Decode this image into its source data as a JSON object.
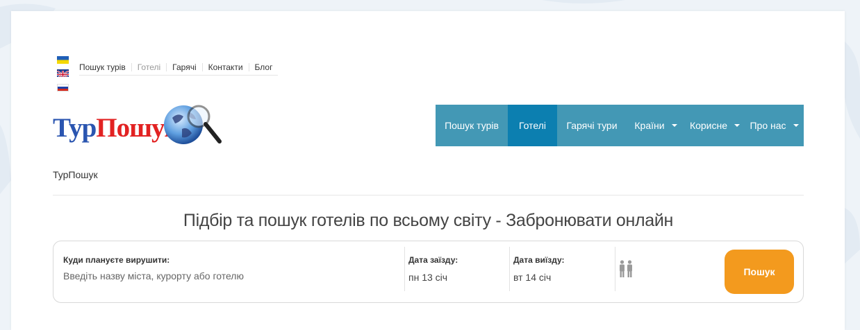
{
  "languages": [
    {
      "name": "uk",
      "icon": "flag-ukraine-icon"
    },
    {
      "name": "en",
      "icon": "flag-uk-icon"
    },
    {
      "name": "ru",
      "icon": "flag-russia-icon"
    }
  ],
  "top_links": [
    {
      "label": "Пошук турів",
      "active": false
    },
    {
      "label": "Готелі",
      "active": true
    },
    {
      "label": "Гарячі",
      "active": false
    },
    {
      "label": "Контакти",
      "active": false
    },
    {
      "label": "Блог",
      "active": false
    }
  ],
  "logo": {
    "part1": "Тур",
    "part2": "Пошук",
    "icon": "globe-magnifier-icon"
  },
  "main_nav": [
    {
      "label": "Пошук турів",
      "active": false,
      "dropdown": false
    },
    {
      "label": "Готелі",
      "active": true,
      "dropdown": false
    },
    {
      "label": "Гарячі тури",
      "active": false,
      "dropdown": false
    },
    {
      "label": "Країни",
      "active": false,
      "dropdown": true
    },
    {
      "label": "Корисне",
      "active": false,
      "dropdown": true
    },
    {
      "label": "Про нас",
      "active": false,
      "dropdown": true
    }
  ],
  "breadcrumb": "ТурПошук",
  "heading": "Підбір та пошук готелів по всьому світу - Забронювати онлайн",
  "search": {
    "destination_label": "Куди плануєте вирушити:",
    "destination_placeholder": "Введіть назву міста, курорту або готелю",
    "checkin_label": "Дата заїзду:",
    "checkin_value": "пн 13 січ",
    "checkout_label": "Дата виїзду:",
    "checkout_value": "вт 14 січ",
    "guests_icon": "two-persons-icon",
    "button_label": "Пошук"
  },
  "colors": {
    "nav_bg": "#4398b5",
    "nav_active": "#0c7fb0",
    "search_button": "#f39a1e",
    "logo_blue": "#2a55b0",
    "logo_red": "#e22222"
  }
}
